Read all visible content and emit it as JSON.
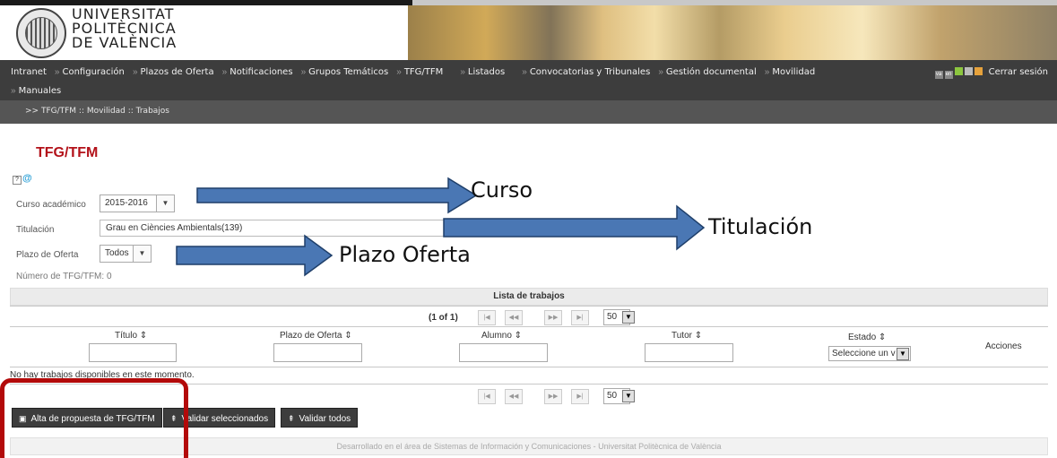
{
  "logo": {
    "line1": "UNIVERSITAT",
    "line2": "POLITÈCNICA",
    "line3": "DE VALÈNCIA"
  },
  "nav": {
    "row1": [
      "Intranet",
      "Configuración",
      "Plazos de Oferta",
      "Notificaciones",
      "Grupos Temáticos",
      "TFG/TFM",
      "Listados",
      "Convocatorias y Tribunales",
      "Gestión documental",
      "Movilidad"
    ],
    "row2": [
      "Manuales"
    ],
    "logout": "Cerrar sesión",
    "lang_icons": [
      "va",
      "en"
    ]
  },
  "breadcrumb": ">> TFG/TFM :: Movilidad :: Trabajos",
  "page": {
    "title": "TFG/TFM"
  },
  "filters": {
    "curso_label": "Curso académico",
    "curso_value": "2015-2016",
    "titulacion_label": "Titulación",
    "titulacion_value": "Grau en Ciències Ambientals(139)",
    "plazo_label": "Plazo de Oferta",
    "plazo_value": "Todos",
    "count_label": "Número de TFG/TFM: 0"
  },
  "table": {
    "header": "Lista de trabajos",
    "page_count": "(1 of 1)",
    "rows_per_page": "50",
    "columns": [
      "Título ⇕",
      "Plazo de Oferta ⇕",
      "Alumno ⇕",
      "Tutor ⇕",
      "Estado ⇕",
      "Acciones"
    ],
    "estado_placeholder": "Seleccione un v",
    "empty_message": "No hay trabajos disponibles en este momento."
  },
  "buttons": {
    "alta": "Alta de propuesta de TFG/TFM",
    "validar_sel": "Validar seleccionados",
    "validar_todos": "Validar todos"
  },
  "footer": "Desarrollado en el área de Sistemas de Información y Comunicaciones - Universitat Politècnica de València",
  "annotations": {
    "curso": "Curso",
    "titulacion": "Titulación",
    "plazo": "Plazo Oferta"
  },
  "colors": {
    "nav_bg": "#3d3d3d",
    "title_red": "#b3121a",
    "arrow_blue": "#4a77b4",
    "annotation_red": "#b30a0a"
  }
}
